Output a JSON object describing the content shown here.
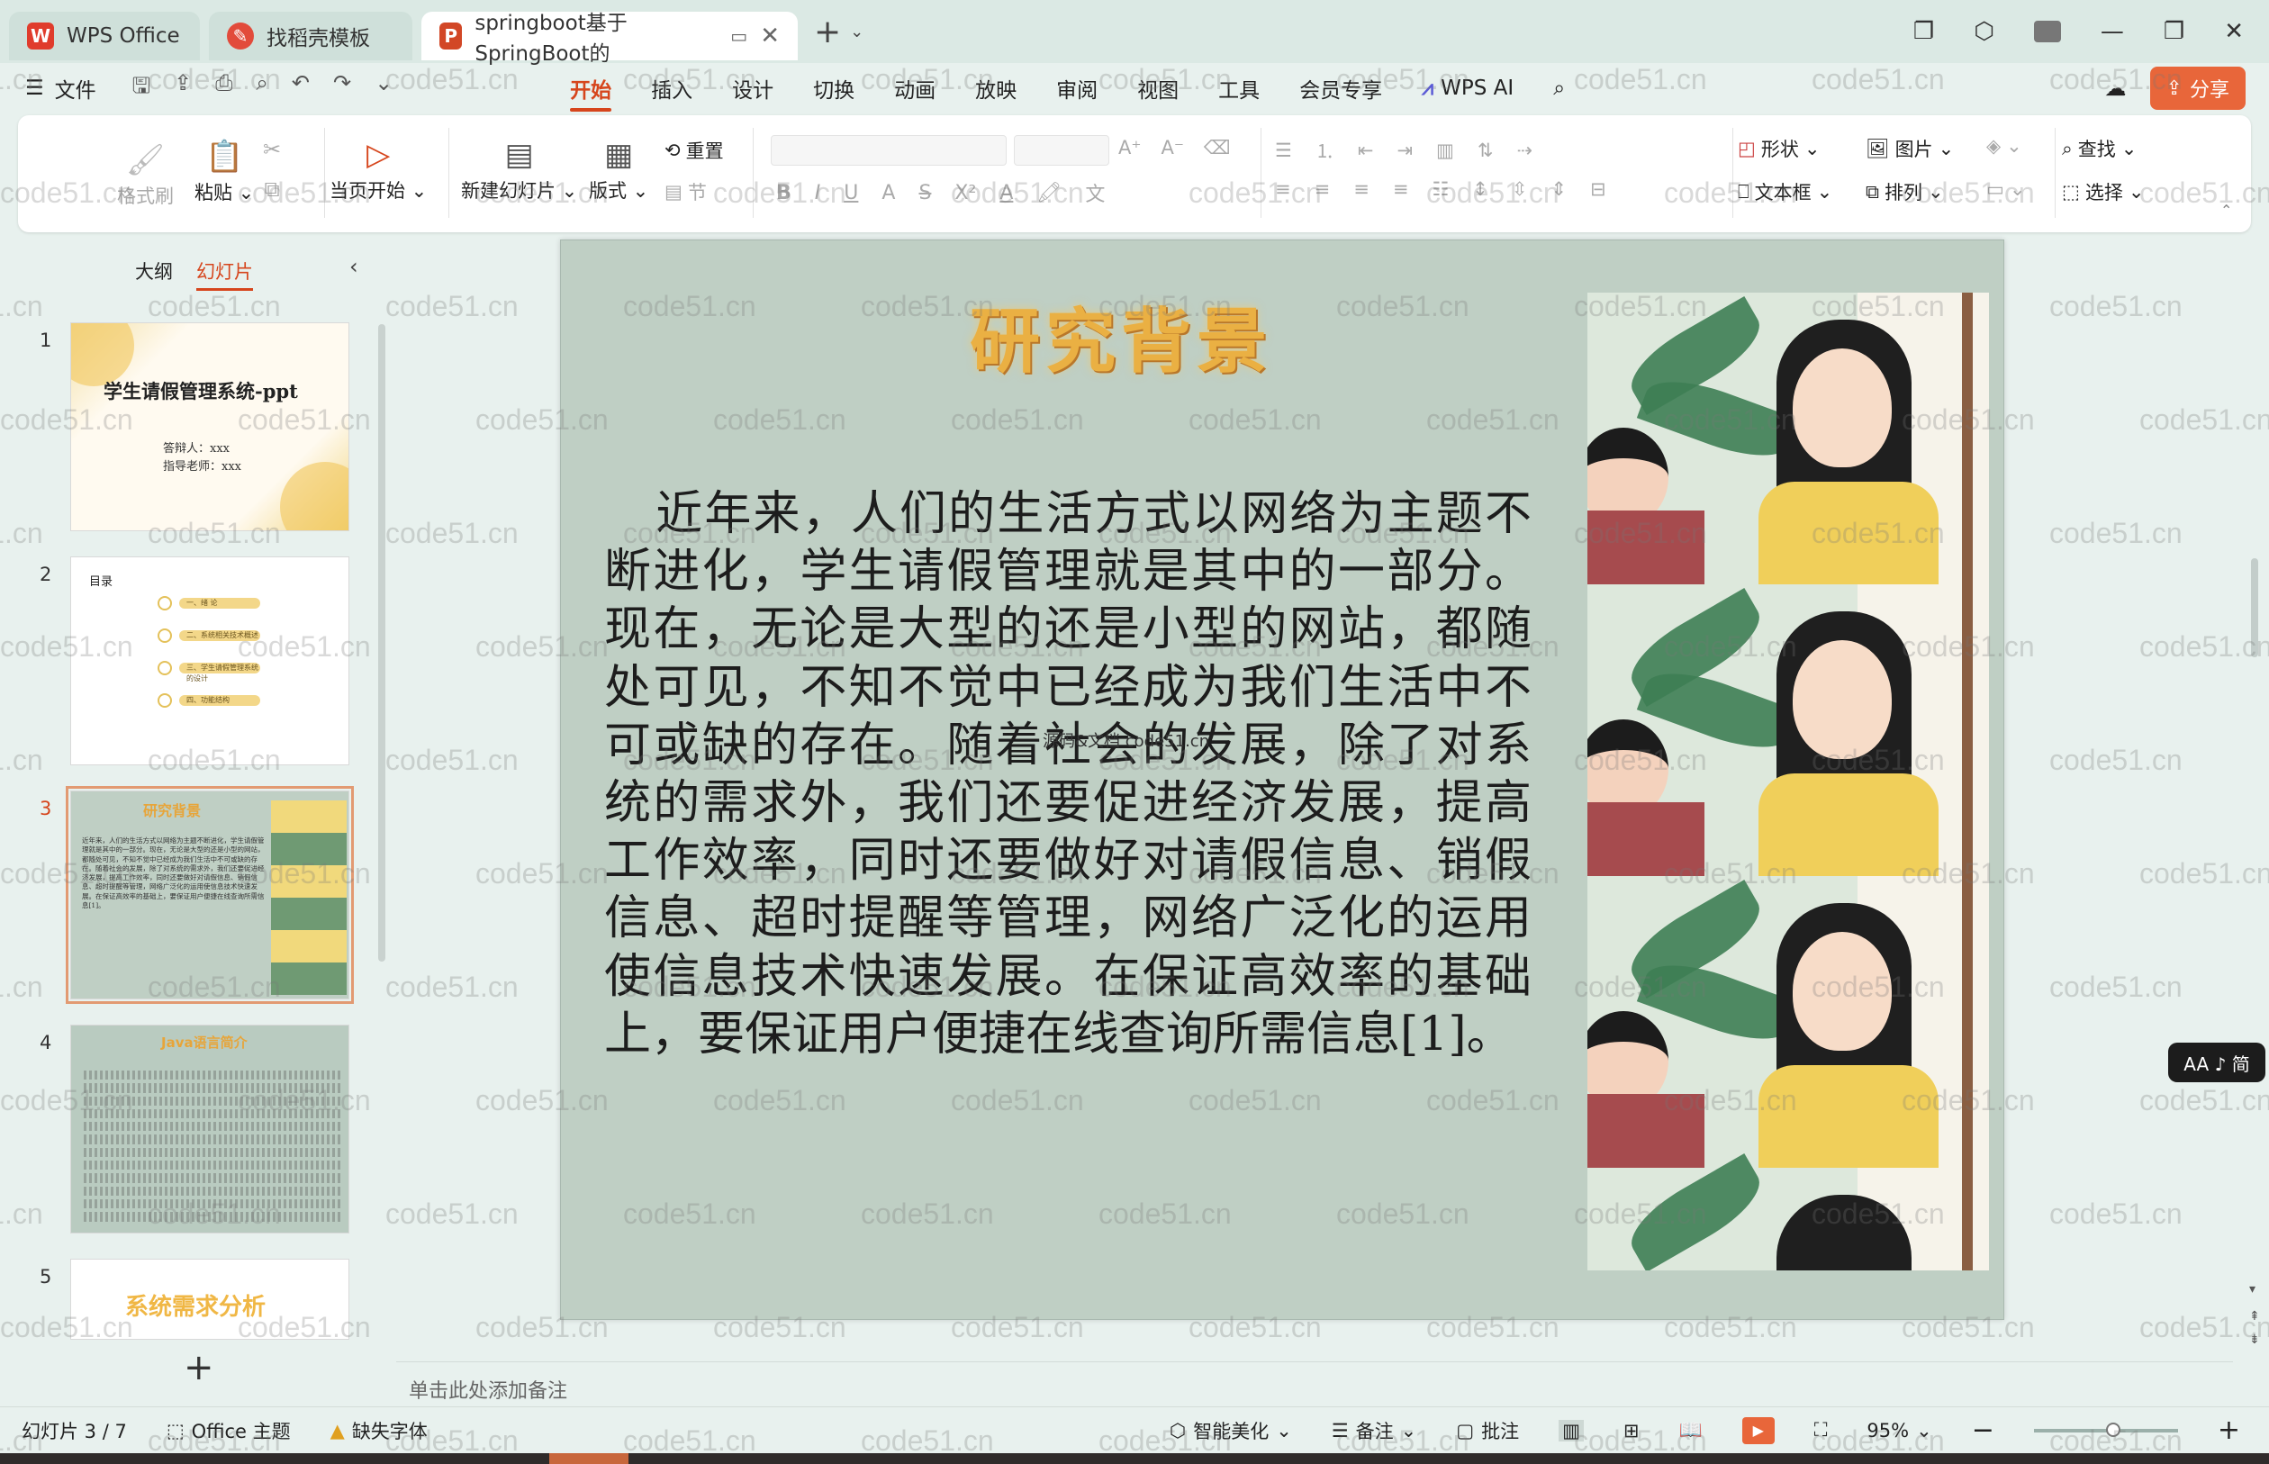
{
  "tabs": [
    {
      "label": "WPS Office",
      "icon": "wps-logo-icon",
      "color": "#e03c2c"
    },
    {
      "label": "找稻壳模板",
      "icon": "docer-logo-icon",
      "color": "#e24b3b"
    },
    {
      "label": "springboot基于SpringBoot的",
      "icon": "presentation-logo-icon",
      "color": "#d24726",
      "active": true
    }
  ],
  "menu": {
    "file": "文件",
    "tabs": [
      "开始",
      "插入",
      "设计",
      "切换",
      "动画",
      "放映",
      "审阅",
      "视图",
      "工具",
      "会员专享"
    ],
    "active_tab": "开始",
    "wps_ai": "WPS AI",
    "share": "分享"
  },
  "ribbon": {
    "format_painter": "格式刷",
    "paste": "粘贴",
    "play_from_current": "当页开始",
    "new_slide": "新建幻灯片",
    "layout": "版式",
    "reset": "重置",
    "section": "节",
    "shape": "形状",
    "picture": "图片",
    "find": "查找",
    "textbox": "文本框",
    "arrange": "排列",
    "select": "选择",
    "bold": "B",
    "italic": "I",
    "underline": "U",
    "strike": "S",
    "superscript": "X²"
  },
  "panel": {
    "tab_outline": "大纲",
    "tab_slides": "幻灯片",
    "slides": [
      {
        "num": "1",
        "title": "学生请假管理系统-ppt",
        "sub1": "答辩人：xxx",
        "sub2": "指导老师：xxx"
      },
      {
        "num": "2",
        "title": "目录",
        "items": [
          "一、绪 论",
          "二、系统相关技术概述",
          "三、学生请假管理系统的设计",
          "四、功能结构"
        ]
      },
      {
        "num": "3",
        "title": "研究背景"
      },
      {
        "num": "4",
        "title": "Java语言简介"
      },
      {
        "num": "5",
        "title": "系统需求分析"
      }
    ]
  },
  "slide": {
    "title": "研究背景",
    "body": "近年来，人们的生活方式以网络为主题不断进化，学生请假管理就是其中的一部分。现在，无论是大型的还是小型的网站，都随处可见，不知不觉中已经成为我们生活中不可或缺的存在。随着社会的发展，除了对系统的需求外，我们还要促进经济发展，提高工作效率，同时还要做好对请假信息、销假信息、超时提醒等管理，网络广泛化的运用使信息技术快速发展。在保证高效率的基础上，要保证用户便捷在线查询所需信息[1]。",
    "caption": "源码&文档 code51.cn"
  },
  "notes_placeholder": "单击此处添加备注",
  "status": {
    "slide_counter": "幻灯片 3 / 7",
    "theme": "Office 主题",
    "missing_font": "缺失字体",
    "smart_beautify": "智能美化",
    "notes": "备注",
    "comments": "批注",
    "zoom": "95%",
    "zoom_fraction": 0.55
  },
  "aa_badge": "AA ♪ 简",
  "watermark": "code51.cn",
  "colors": {
    "accent": "#d6451c",
    "share": "#e8663a",
    "slide_bg": "#bfcfc4",
    "title_gold": "#eab043"
  }
}
